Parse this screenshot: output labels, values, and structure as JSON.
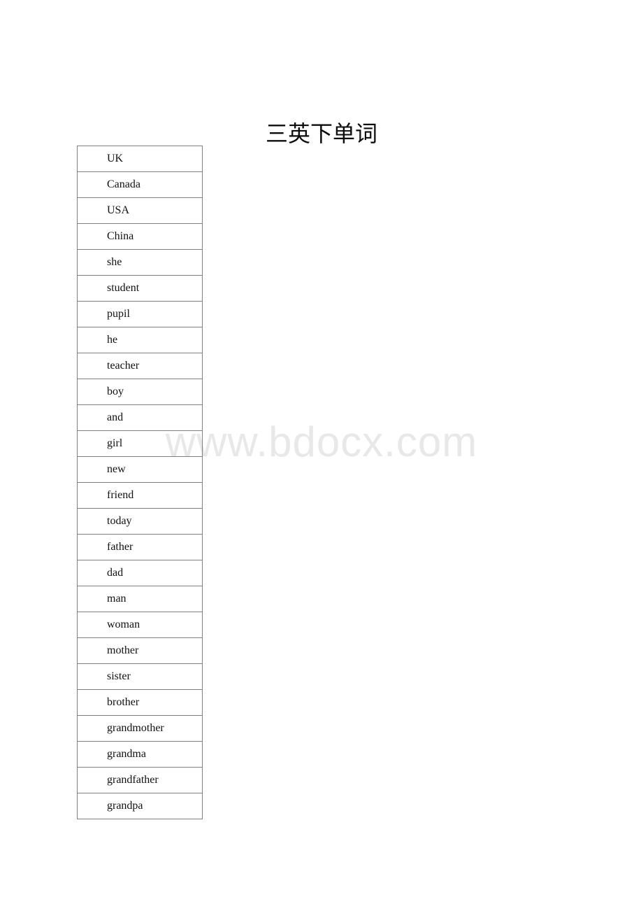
{
  "document": {
    "title": "三英下单词",
    "background_color": "#ffffff",
    "text_color": "#111111"
  },
  "watermark": {
    "text": "www.bdocx.com",
    "color": "#e8e8e8"
  },
  "word_table": {
    "border_color": "#808080",
    "column_count": 1,
    "row_count": 26,
    "words": [
      "UK",
      "Canada",
      "USA",
      "China",
      "she",
      "student",
      "pupil",
      "he",
      "teacher",
      "boy",
      "and",
      "girl",
      "new",
      "friend",
      "today",
      "father",
      "dad",
      "man",
      "woman",
      "mother",
      "sister",
      "brother",
      "grandmother",
      "grandma",
      "grandfather",
      "grandpa"
    ]
  }
}
